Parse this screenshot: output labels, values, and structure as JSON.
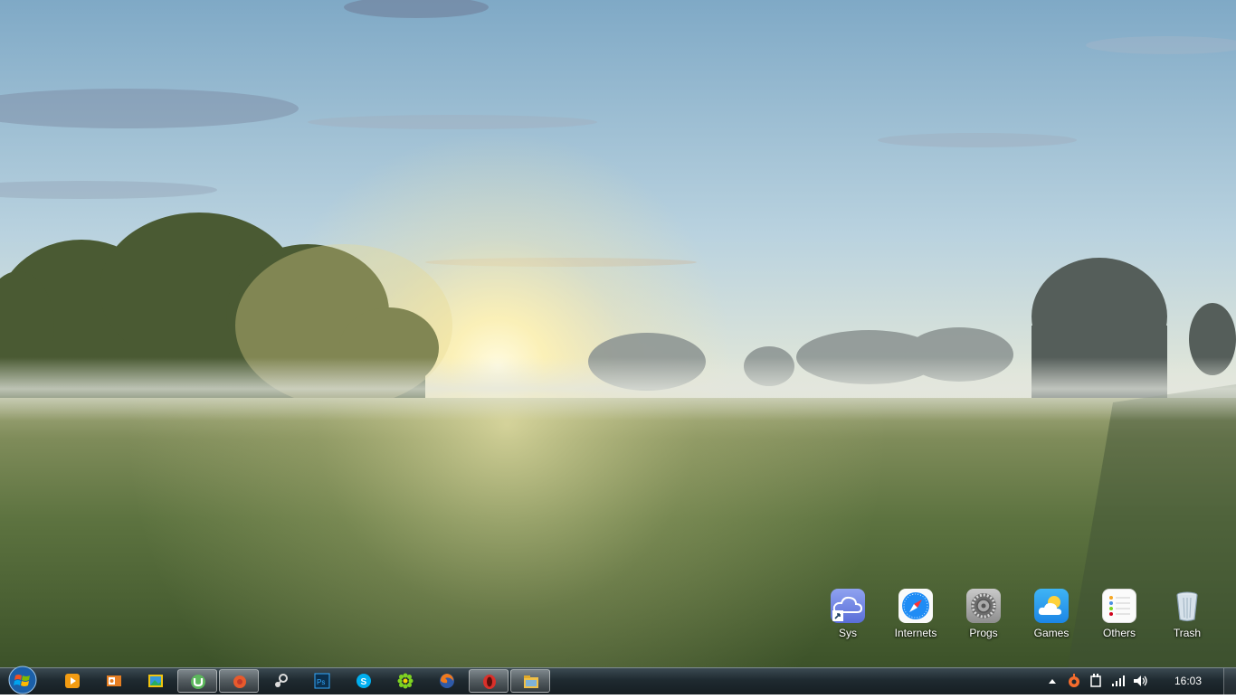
{
  "desktop": {
    "wallpaper": "misty-meadow-sunrise",
    "icons": [
      {
        "label": "Sys",
        "icon": "cloud-folder-icon"
      },
      {
        "label": "Internets",
        "icon": "safari-compass-icon"
      },
      {
        "label": "Progs",
        "icon": "settings-gear-icon"
      },
      {
        "label": "Games",
        "icon": "weather-cloud-icon"
      },
      {
        "label": "Others",
        "icon": "notes-list-icon"
      },
      {
        "label": "Trash",
        "icon": "recycle-bin-icon"
      }
    ]
  },
  "taskbar": {
    "start_button": "windows-start-orb",
    "pinned": [
      {
        "icon": "media-player-icon",
        "active": false
      },
      {
        "icon": "outlook-icon",
        "active": false
      },
      {
        "icon": "photo-viewer-icon",
        "active": false
      },
      {
        "icon": "utorrent-icon",
        "active": true
      },
      {
        "icon": "red-app-icon",
        "active": true
      },
      {
        "icon": "steam-icon",
        "active": false
      },
      {
        "icon": "photoshop-icon",
        "active": false
      },
      {
        "icon": "skype-icon",
        "active": false
      },
      {
        "icon": "icq-flower-icon",
        "active": false
      },
      {
        "icon": "firefox-icon",
        "active": false
      },
      {
        "icon": "opera-icon",
        "active": true
      },
      {
        "icon": "file-explorer-icon",
        "active": true
      }
    ],
    "tray": {
      "icons": [
        "show-hidden-icons-arrow",
        "origin-icon",
        "power-plug-icon",
        "network-signal-icon",
        "volume-icon"
      ],
      "clock": "16:03"
    }
  },
  "colors": {
    "taskbar": "#1f2a30",
    "accent_red": "#d9302a"
  }
}
